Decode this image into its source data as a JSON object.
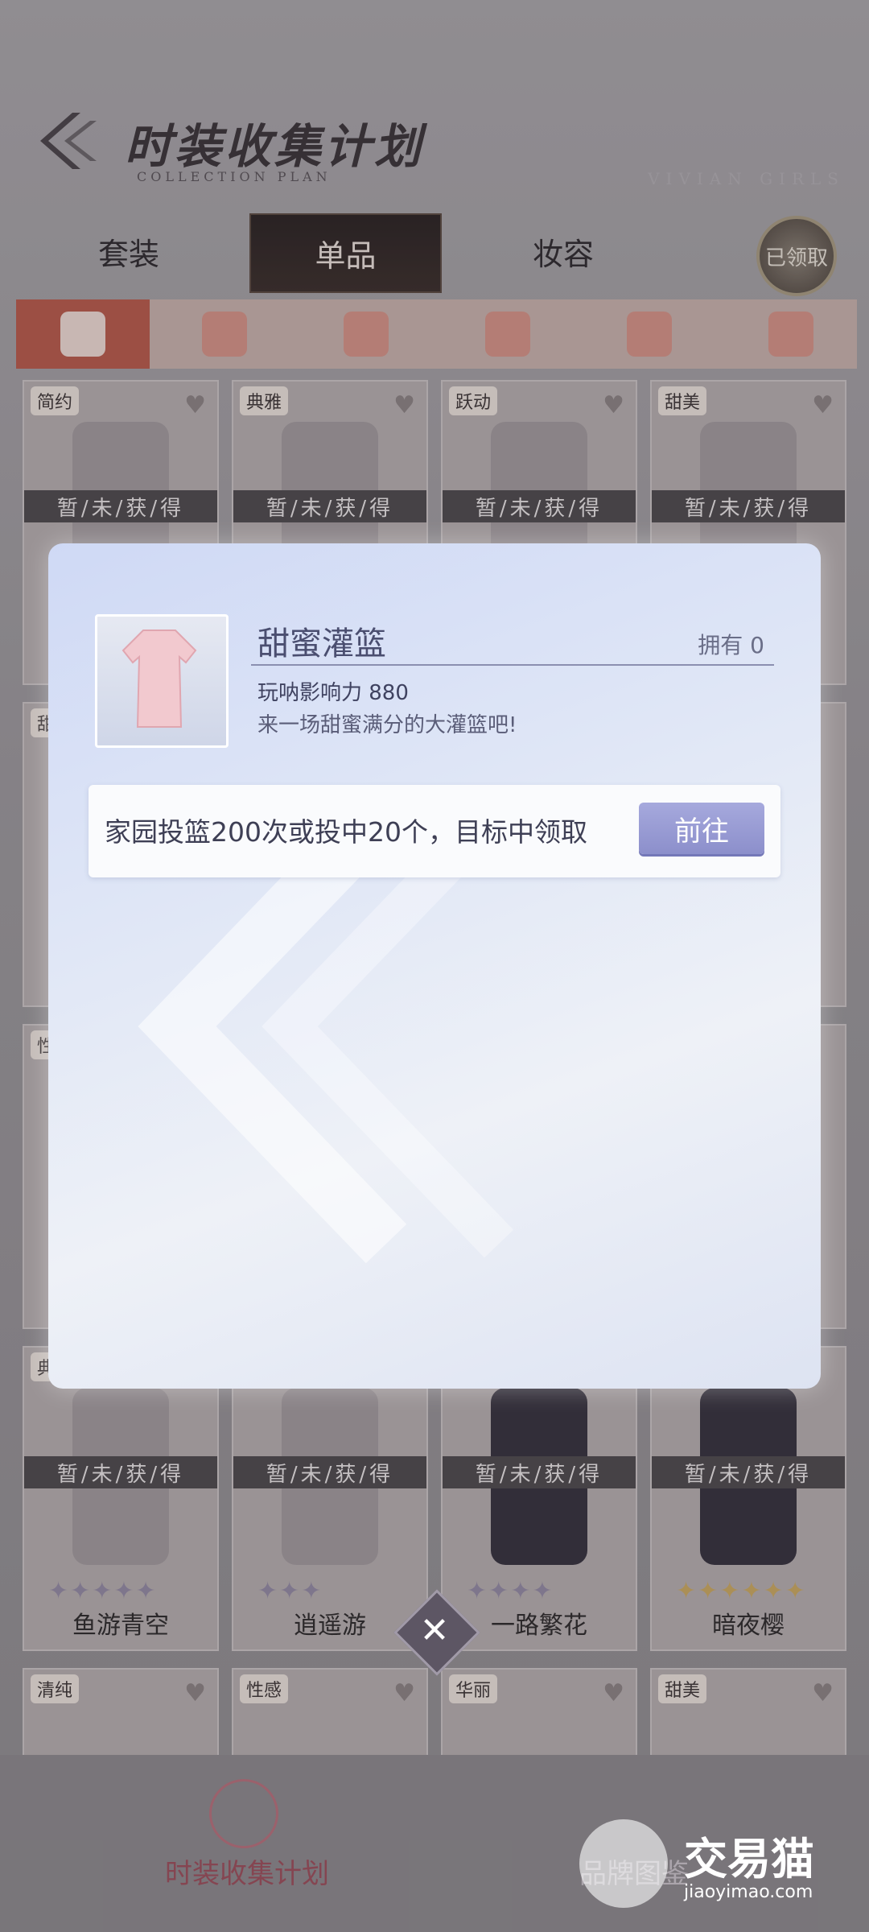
{
  "header": {
    "title": "时装收集计划",
    "subtitle": "COLLECTION PLAN",
    "watermark": "VIVIAN GIRLS"
  },
  "tabs": [
    {
      "label": "套装",
      "active": false
    },
    {
      "label": "单品",
      "active": true
    },
    {
      "label": "妆容",
      "active": false
    }
  ],
  "claimed_label": "已领取",
  "categories": [
    {
      "icon": "dress-icon",
      "active": true
    },
    {
      "icon": "jacket-icon",
      "active": false
    },
    {
      "icon": "skirt-icon",
      "active": false
    },
    {
      "icon": "hair-icon",
      "active": false
    },
    {
      "icon": "coat-icon",
      "active": false
    },
    {
      "icon": "socks-icon",
      "active": false
    }
  ],
  "cards_row1": [
    {
      "tag": "简约",
      "status": "暂/未/获/得"
    },
    {
      "tag": "典雅",
      "status": "暂/未/获/得"
    },
    {
      "tag": "跃动",
      "status": "暂/未/获/得"
    },
    {
      "tag": "甜美",
      "status": "暂/未/获/得"
    }
  ],
  "cards_row_mid": [
    {
      "tag": "甜"
    },
    {
      "tag": "性"
    },
    {
      "tag": "典"
    }
  ],
  "cards_row4": [
    {
      "name": "鱼游青空",
      "status": "暂/未/获/得",
      "stars": "✦✦✦✦✦"
    },
    {
      "name": "逍遥游",
      "status": "暂/未/获/得",
      "stars": "✦✦✦"
    },
    {
      "name": "一路繁花",
      "status": "暂/未/获/得",
      "stars": "✦✦✦✦"
    },
    {
      "name": "暗夜樱",
      "status": "暂/未/获/得",
      "stars": "✦✦✦✦✦✦"
    }
  ],
  "cards_row5": [
    {
      "tag": "清纯"
    },
    {
      "tag": "性感"
    },
    {
      "tag": "华丽"
    },
    {
      "tag": "甜美"
    }
  ],
  "bottom_nav": {
    "item1": "时装收集计划",
    "item2": "品牌图鉴"
  },
  "watermark": {
    "brand": "交易猫",
    "url": "jiaoyimao.com"
  },
  "modal": {
    "item_name": "甜蜜灌篮",
    "owned": "拥有 0",
    "influence": "玩呐影响力  880",
    "description": "来一场甜蜜满分的大灌篮吧!",
    "task": "家园投篮200次或投中20个，目标中领取",
    "goto_label": "前往"
  },
  "close_symbol": "✕"
}
